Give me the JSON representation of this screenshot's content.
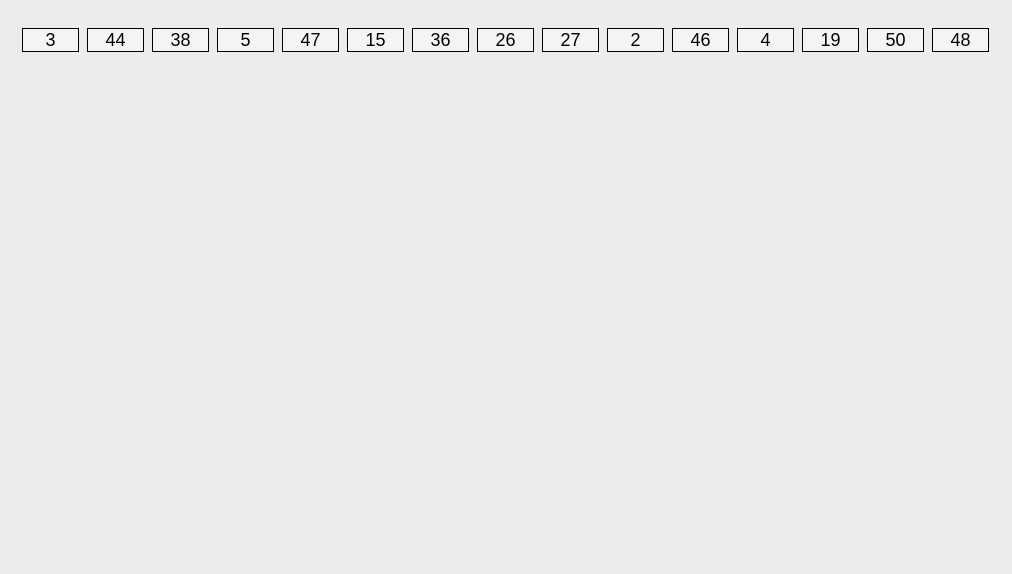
{
  "cells": [
    "3",
    "44",
    "38",
    "5",
    "47",
    "15",
    "36",
    "26",
    "27",
    "2",
    "46",
    "4",
    "19",
    "50",
    "48"
  ]
}
